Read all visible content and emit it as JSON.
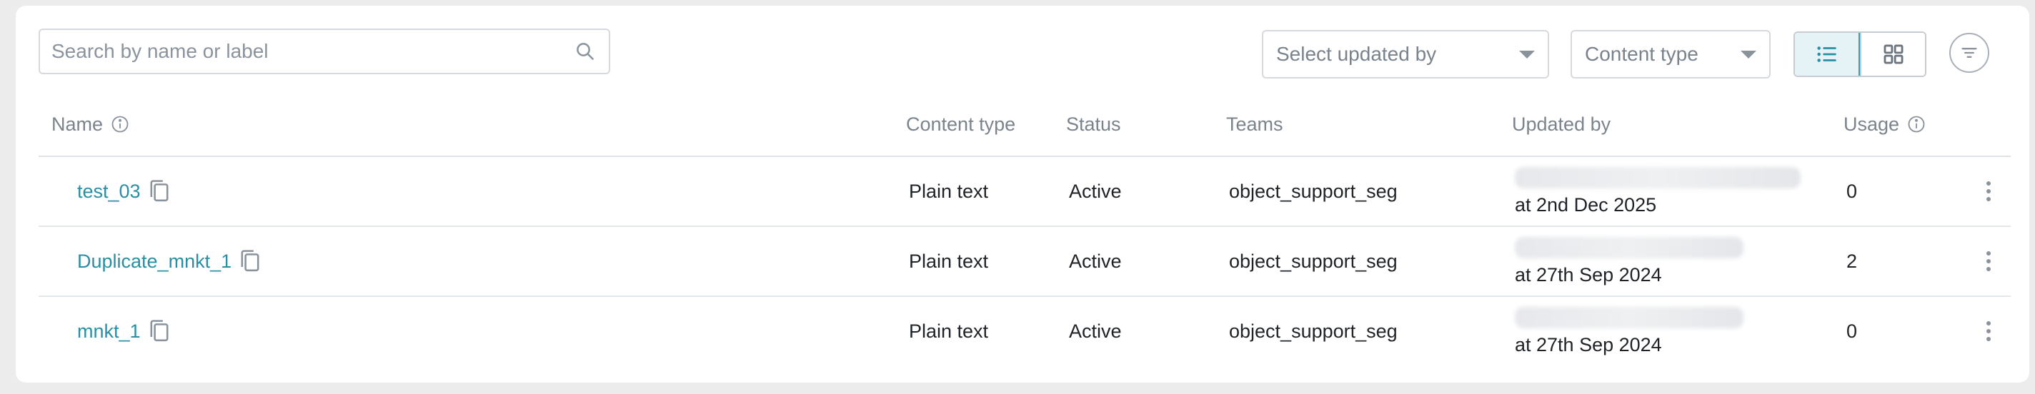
{
  "toolbar": {
    "search_placeholder": "Search by name or label",
    "updated_by_placeholder": "Select updated by",
    "content_type_placeholder": "Content type"
  },
  "columns": {
    "name": "Name",
    "content_type": "Content type",
    "status": "Status",
    "teams": "Teams",
    "updated_by": "Updated by",
    "usage": "Usage"
  },
  "rows": [
    {
      "name": "test_03",
      "content_type": "Plain text",
      "status": "Active",
      "teams": "object_support_seg",
      "updated_at": "at 2nd Dec 2025",
      "usage": "0"
    },
    {
      "name": "Duplicate_mnkt_1",
      "content_type": "Plain text",
      "status": "Active",
      "teams": "object_support_seg",
      "updated_at": "at 27th Sep 2024",
      "usage": "2"
    },
    {
      "name": "mnkt_1",
      "content_type": "Plain text",
      "status": "Active",
      "teams": "object_support_seg",
      "updated_at": "at 27th Sep 2024",
      "usage": "0"
    }
  ],
  "colors": {
    "accent": "#2b8fa3",
    "active_toggle_bg": "#e6f3f6",
    "muted_text": "#7b838c"
  },
  "icons": [
    "search-icon",
    "chevron-down-icon",
    "list-view-icon",
    "grid-view-icon",
    "filter-icon",
    "info-icon",
    "copy-icon",
    "more-vertical-icon"
  ]
}
